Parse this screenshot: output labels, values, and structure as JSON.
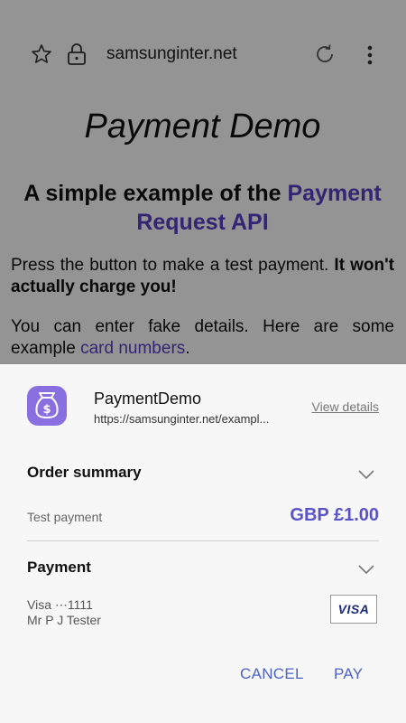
{
  "browser": {
    "url": "samsunginter.net"
  },
  "page": {
    "title": "Payment Demo",
    "subtitle_plain": "A simple example of the ",
    "subtitle_link": "Payment Request API",
    "para1_plain": "Press the button to make a test payment. ",
    "para1_bold": "It won't actually charge you!",
    "para2_plain": "You can enter fake details. Here are some example ",
    "para2_link": "card numbers",
    "para2_end": "."
  },
  "sheet": {
    "app_name": "PaymentDemo",
    "app_url": "https://samsunginter.net/exampl...",
    "view_details": "View details",
    "order_summary": {
      "title": "Order summary",
      "item_label": "Test payment",
      "amount": "GBP £1.00"
    },
    "payment": {
      "title": "Payment",
      "card": "Visa ⋯1111",
      "holder": "Mr P J Tester",
      "card_brand": "VISA"
    },
    "actions": {
      "cancel": "CANCEL",
      "pay": "PAY"
    }
  },
  "colors": {
    "accent": "#5a54c8",
    "link": "#5c3dc7",
    "button": "#4e63c8",
    "app_icon": "#8a6fe0"
  }
}
